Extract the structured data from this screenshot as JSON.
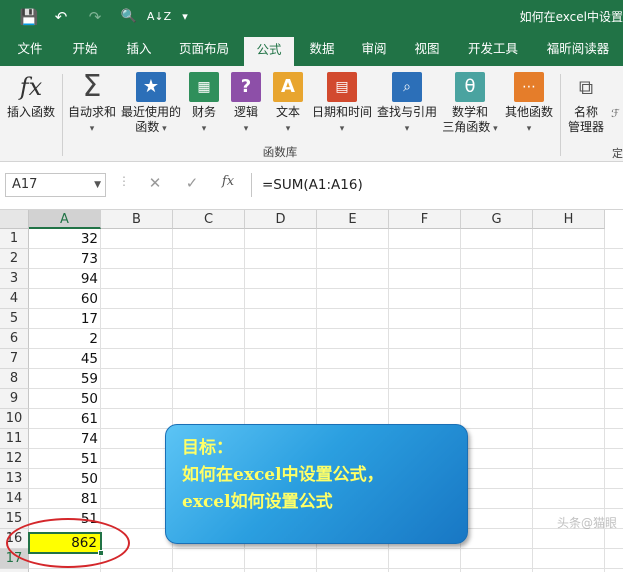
{
  "window": {
    "title": "如何在excel中设置"
  },
  "quick_access": {
    "save": "💾",
    "undo": "↶",
    "redo": "↷",
    "print_preview": "🔍",
    "sort": "A↓Z",
    "customize": "▾"
  },
  "tabs": [
    "文件",
    "开始",
    "插入",
    "页面布局",
    "公式",
    "数据",
    "审阅",
    "视图",
    "开发工具",
    "福昕阅读器"
  ],
  "active_tab": "公式",
  "ribbon": {
    "insert_function": "插入函数",
    "autosum": "自动求和",
    "recent_line1": "最近使用的",
    "recent_line2": "函数",
    "financial": "财务",
    "logical": "逻辑",
    "text": "文本",
    "datetime": "日期和时间",
    "lookup": "查找与引用",
    "math_line1": "数学和",
    "math_line2": "三角函数",
    "other": "其他函数",
    "name_line1": "名称",
    "name_line2": "管理器",
    "group_label": "函数库",
    "partial_right": "定"
  },
  "formula_bar": {
    "name_box": "A17",
    "formula": "=SUM(A1:A16)",
    "fx": "fx"
  },
  "columns": [
    "A",
    "B",
    "C",
    "D",
    "E",
    "F",
    "G",
    "H"
  ],
  "rows": [
    "1",
    "2",
    "3",
    "4",
    "5",
    "6",
    "7",
    "8",
    "9",
    "10",
    "11",
    "12",
    "13",
    "14",
    "15",
    "16",
    "17",
    "18"
  ],
  "column_a_values": [
    "32",
    "73",
    "94",
    "60",
    "17",
    "2",
    "45",
    "59",
    "50",
    "61",
    "74",
    "51",
    "50",
    "81",
    "51",
    "62"
  ],
  "active_cell_value": "862",
  "callout": {
    "line1": "目标：",
    "line2": "如何在excel中设置公式，",
    "line3": "excel如何设置公式"
  },
  "watermark": "头条@猫眼"
}
